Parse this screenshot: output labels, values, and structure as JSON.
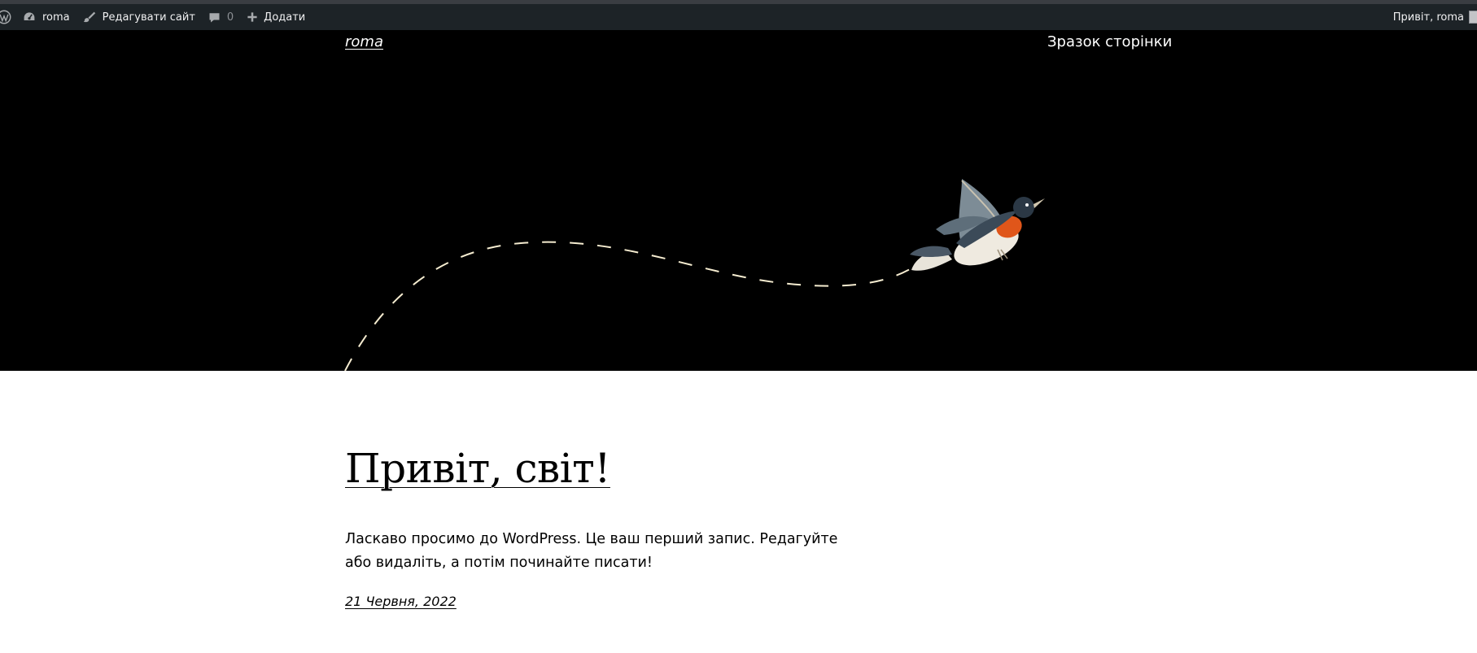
{
  "admin_bar": {
    "wp_logo_icon": "wordpress-logo-icon",
    "site_name": "roma",
    "site_icon": "dashboard-icon",
    "edit_site": "Редагувати сайт",
    "edit_icon": "brush-icon",
    "comments_count": "0",
    "comments_icon": "comment-icon",
    "new_label": "Додати",
    "new_icon": "plus-icon",
    "greeting": "Привіт, roma"
  },
  "header": {
    "site_title": "roma",
    "nav": [
      "Зразок сторінки"
    ]
  },
  "post": {
    "title": "Привіт, світ!",
    "excerpt": "Ласкаво просимо до WordPress. Це ваш перший запис. Редагуйте або видаліть, а потім починайте писати!",
    "date": "21 Червня, 2022"
  },
  "colors": {
    "admin_bar_bg": "#1d2327",
    "hero_bg": "#000000",
    "text": "#000000",
    "dash_line": "#f5ecd0"
  }
}
